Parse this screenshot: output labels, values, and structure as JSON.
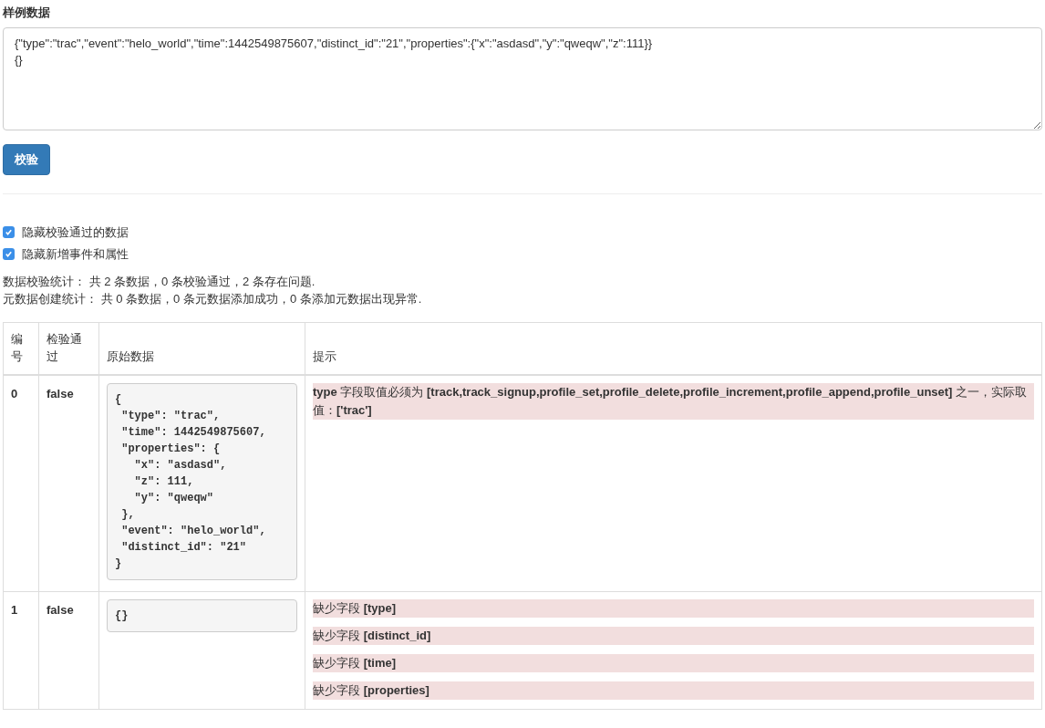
{
  "sample": {
    "label": "样例数据",
    "value": "{\"type\":\"trac\",\"event\":\"helo_world\",\"time\":1442549875607,\"distinct_id\":\"21\",\"properties\":{\"x\":\"asdasd\",\"y\":\"qweqw\",\"z\":111}}\n{}"
  },
  "validate_button": "校验",
  "options": [
    {
      "label": "隐藏校验通过的数据",
      "checked": true
    },
    {
      "label": "隐藏新增事件和属性",
      "checked": true
    }
  ],
  "stats": [
    "数据校验统计： 共 2 条数据，0 条校验通过，2 条存在问题.",
    "元数据创建统计： 共 0 条数据，0 条元数据添加成功，0 条添加元数据出现异常."
  ],
  "table": {
    "columns": [
      "编号",
      "检验通过",
      "原始数据",
      "提示"
    ],
    "rows": [
      {
        "number": "0",
        "passed": "false",
        "raw": "{\n \"type\": \"trac\",\n \"time\": 1442549875607,\n \"properties\": {\n   \"x\": \"asdasd\",\n   \"z\": 111,\n   \"y\": \"qweqw\"\n },\n \"event\": \"helo_world\",\n \"distinct_id\": \"21\"\n}",
        "hints": [
          "**type** 字段取值必须为 **[track,track_signup,profile_set,profile_delete,profile_increment,profile_append,profile_unset]** 之一，实际取值：**['trac']**"
        ]
      },
      {
        "number": "1",
        "passed": "false",
        "raw": "{}",
        "hints": [
          "缺少字段 **[type]**",
          "缺少字段 **[distinct_id]**",
          "缺少字段 **[time]**",
          "缺少字段 **[properties]**"
        ]
      }
    ]
  }
}
